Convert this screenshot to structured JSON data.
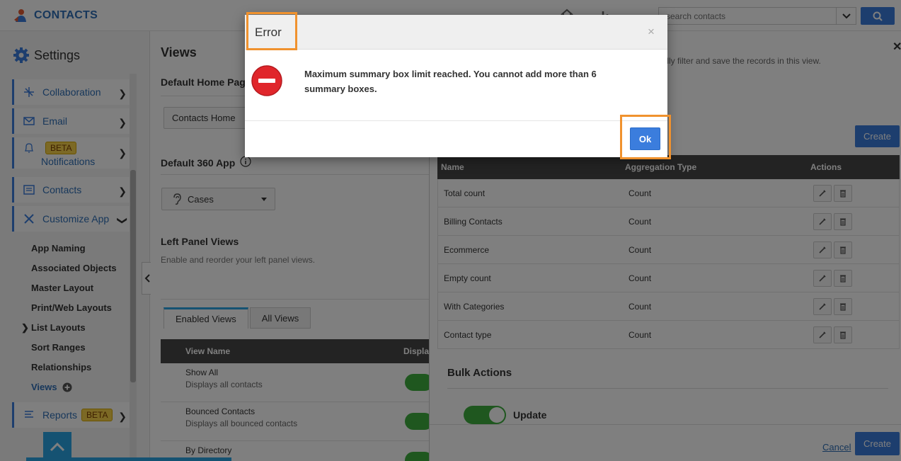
{
  "app": {
    "name": "CONTACTS"
  },
  "search": {
    "placeholder": "search contacts"
  },
  "sidebar": {
    "title": "Settings",
    "nav": [
      {
        "label": "Collaboration"
      },
      {
        "label": "Email"
      },
      {
        "label": "Notifications",
        "badge": "BETA"
      },
      {
        "label": "Contacts"
      },
      {
        "label": "Customize App"
      },
      {
        "label": "Reports",
        "badge": "BETA"
      }
    ],
    "sub_items": [
      "App Naming",
      "Associated Objects",
      "Master Layout",
      "Print/Web Layouts",
      "List Layouts",
      "Sort Ranges",
      "Relationships",
      "Views"
    ]
  },
  "main": {
    "title": "Views",
    "default_home_label": "Default Home Pag",
    "default_home_value": "Contacts Home",
    "default_360_label": "Default 360 App",
    "default_360_value": "Cases",
    "left_panel_title": "Left Panel Views",
    "left_panel_desc": "Enable and reorder your left panel views.",
    "tabs": [
      "Enabled Views",
      "All Views"
    ],
    "table_headers": [
      "View Name",
      "Displa"
    ],
    "rows": [
      {
        "name": "Show All",
        "desc": "Displays all contacts"
      },
      {
        "name": "Bounced Contacts",
        "desc": "Displays all bounced contacts"
      },
      {
        "name": "By Directory",
        "desc": ""
      }
    ]
  },
  "right_panel": {
    "hint": "atically filter and save the records in this view.",
    "create_label": "Create",
    "summary_headers": [
      "Name",
      "Aggregation Type",
      "Actions"
    ],
    "summary_rows": [
      {
        "name": "Total count",
        "type": "Count"
      },
      {
        "name": "Billing Contacts",
        "type": "Count"
      },
      {
        "name": "Ecommerce",
        "type": "Count"
      },
      {
        "name": "Empty count",
        "type": "Count"
      },
      {
        "name": "With Categories",
        "type": "Count"
      },
      {
        "name": "Contact type",
        "type": "Count"
      }
    ],
    "bulk_title": "Bulk Actions",
    "bulk_update_label": "Update",
    "cancel_label": "Cancel",
    "create_footer_label": "Create"
  },
  "dialog": {
    "title": "Error",
    "close_glyph": "×",
    "message": "Maximum summary box limit reached. You cannot add more than 6 summary boxes.",
    "ok_label": "Ok"
  },
  "colors": {
    "accent": "#3b7ddd",
    "highlight": "#f0922e",
    "toggle": "#3fae3f"
  }
}
